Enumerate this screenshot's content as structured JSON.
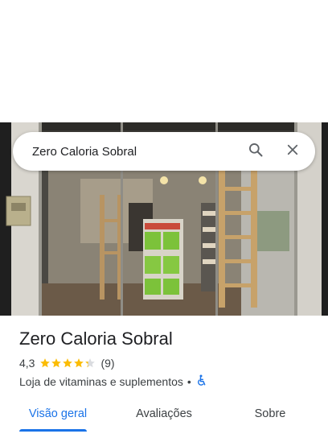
{
  "search": {
    "query": "Zero Caloria Sobral"
  },
  "place": {
    "name": "Zero Caloria Sobral",
    "rating": "4,3",
    "rating_value": 4.3,
    "review_count": "(9)",
    "category": "Loja de vitaminas e suplementos",
    "separator": "•"
  },
  "tabs": [
    {
      "label": "Visão geral",
      "active": true
    },
    {
      "label": "Avaliações",
      "active": false
    },
    {
      "label": "Sobre",
      "active": false
    }
  ],
  "colors": {
    "accent": "#1a73e8",
    "star": "#fbbc04",
    "accessibility": "#1a73e8"
  },
  "icons": {
    "search": "search-icon",
    "close": "close-icon",
    "accessibility": "wheelchair-icon"
  }
}
